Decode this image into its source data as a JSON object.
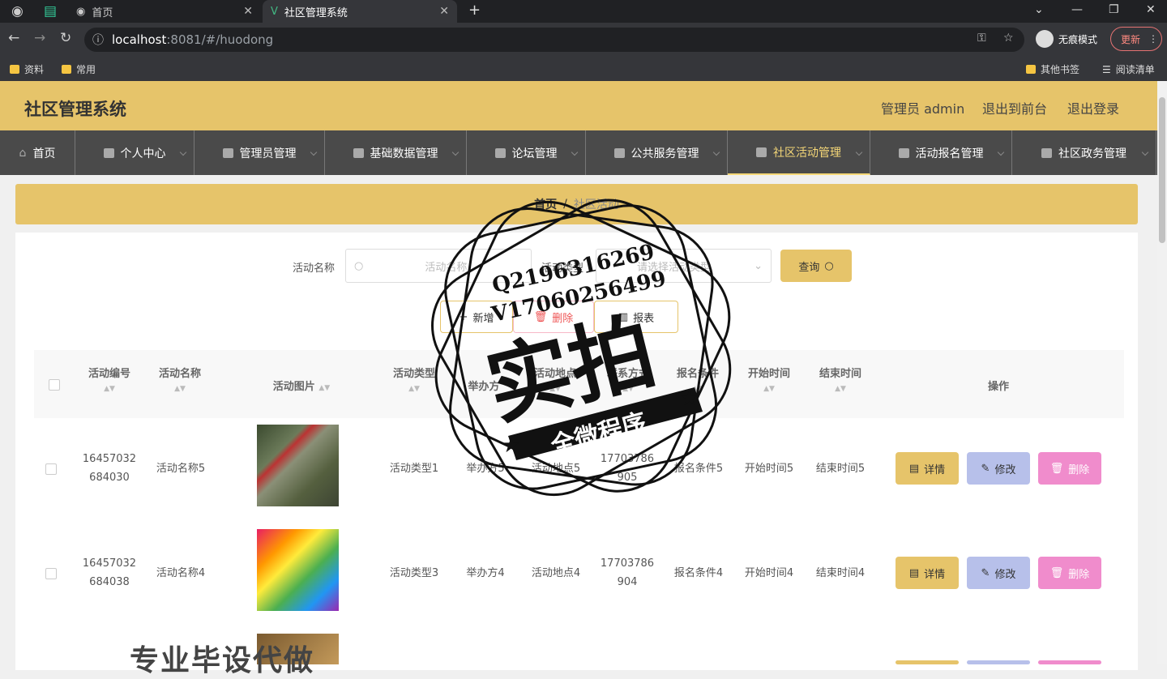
{
  "browser": {
    "tabs": [
      {
        "label": "首页"
      },
      {
        "label": "社区管理系统"
      }
    ],
    "url_host": "localhost",
    "url_rest": ":8081/#/huodong",
    "incognito_label": "无痕模式",
    "update_label": "更新",
    "bookmarks": [
      {
        "label": "资料"
      },
      {
        "label": "常用"
      }
    ],
    "bookmarks_right": [
      {
        "label": "其他书签"
      },
      {
        "label": "阅读清单"
      }
    ]
  },
  "header": {
    "title": "社区管理系统",
    "user": "管理员 admin",
    "front": "退出到前台",
    "logout": "退出登录"
  },
  "menu": {
    "items": [
      {
        "label": "首页"
      },
      {
        "label": "个人中心"
      },
      {
        "label": "管理员管理"
      },
      {
        "label": "基础数据管理"
      },
      {
        "label": "论坛管理"
      },
      {
        "label": "公共服务管理"
      },
      {
        "label": "社区活动管理"
      },
      {
        "label": "活动报名管理"
      },
      {
        "label": "社区政务管理"
      }
    ]
  },
  "breadcrumb": {
    "home": "首页",
    "sep": "/",
    "current": "社区活动"
  },
  "search": {
    "name_label": "活动名称",
    "name_placeholder": "活动名称",
    "type_label": "活动类型",
    "type_placeholder": "请选择活动类型",
    "query_label": "查询"
  },
  "actions": {
    "add": "新增",
    "delete": "删除",
    "report": "报表"
  },
  "table": {
    "headers": [
      "活动编号",
      "活动名称",
      "活动图片",
      "活动类型",
      "举办方",
      "活动地点",
      "联系方式",
      "报名条件",
      "开始时间",
      "结束时间",
      "操作"
    ],
    "rows": [
      {
        "id1": "16457032",
        "id2": "684030",
        "name": "活动名称5",
        "type": "活动类型1",
        "host": "举办方5",
        "place": "活动地点5",
        "phone1": "17703786",
        "phone2": "905",
        "cond": "报名条件5",
        "start": "开始时间5",
        "end": "结束时间5"
      },
      {
        "id1": "16457032",
        "id2": "684038",
        "name": "活动名称4",
        "type": "活动类型3",
        "host": "举办方4",
        "place": "活动地点4",
        "phone1": "17703786",
        "phone2": "904",
        "cond": "报名条件4",
        "start": "开始时间4",
        "end": "结束时间4"
      }
    ],
    "detail": "详情",
    "edit": "修改",
    "remove": "删除"
  },
  "watermark": {
    "line1": "Q2196316269",
    "line2": "V17060256499",
    "big": "实拍",
    "band": "全微程序",
    "bottom": "专业毕设代做"
  },
  "colors": {
    "accent": "#e6c46a",
    "menu_bg": "#4a4a4a",
    "edit": "#b7c0ea",
    "delete": "#f08ccc"
  }
}
